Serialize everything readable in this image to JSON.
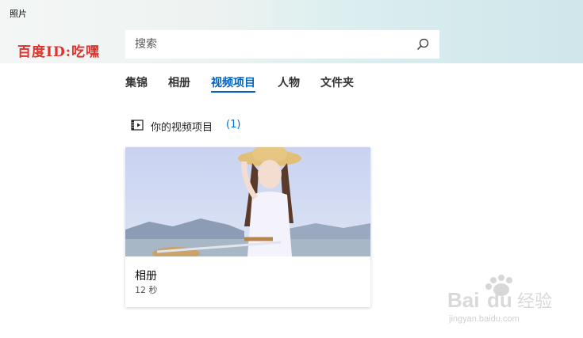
{
  "app": {
    "title": "照片"
  },
  "watermark": {
    "text": "百度ID:吃嘿"
  },
  "search": {
    "placeholder": "搜索",
    "value": ""
  },
  "tabs": [
    {
      "label": "集锦",
      "active": false
    },
    {
      "label": "相册",
      "active": false
    },
    {
      "label": "视频项目",
      "active": true
    },
    {
      "label": "人物",
      "active": false
    },
    {
      "label": "文件夹",
      "active": false
    }
  ],
  "section": {
    "label": "你的视频项目",
    "count": "(1)",
    "icon": "video-project-icon"
  },
  "cards": [
    {
      "title": "相册",
      "duration": "12 秒"
    }
  ],
  "baidu_watermark": {
    "brand": "Bai",
    "brand2": "du",
    "cn": "经验",
    "url": "jingyan.baidu.com"
  },
  "colors": {
    "accent": "#0062c3",
    "count": "#0073cf",
    "watermark_red": "#e0312b"
  }
}
